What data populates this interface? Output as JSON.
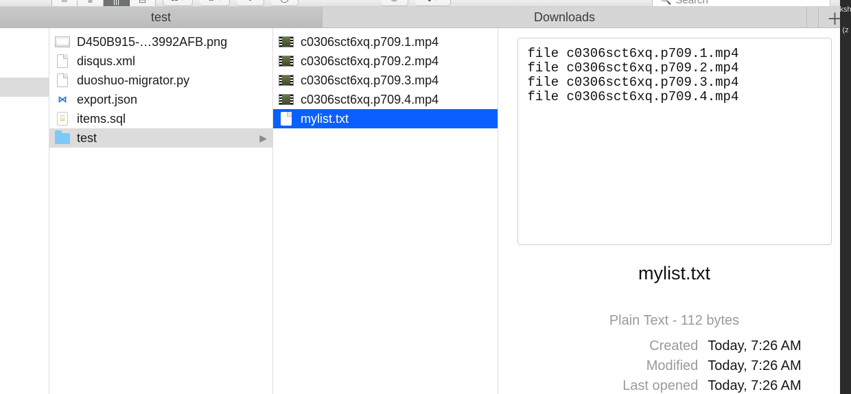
{
  "toolbar": {
    "search_placeholder": "Search"
  },
  "tabs": [
    "test",
    "Downloads"
  ],
  "active_tab_index": 0,
  "right_edge": {
    "top": "ksh",
    "sub": "(z"
  },
  "column1": {
    "items": [
      {
        "name": "D450B915-…3992AFB.png",
        "icon": "png"
      },
      {
        "name": "disqus.xml",
        "icon": "doc"
      },
      {
        "name": "duoshuo-migrator.py",
        "icon": "doc"
      },
      {
        "name": "export.json",
        "icon": "vscode"
      },
      {
        "name": "items.sql",
        "icon": "sql"
      },
      {
        "name": "test",
        "icon": "folder",
        "selected": "gray",
        "has_children": true
      }
    ]
  },
  "column2": {
    "items": [
      {
        "name": "c0306sct6xq.p709.1.mp4",
        "icon": "video"
      },
      {
        "name": "c0306sct6xq.p709.2.mp4",
        "icon": "video"
      },
      {
        "name": "c0306sct6xq.p709.3.mp4",
        "icon": "video"
      },
      {
        "name": "c0306sct6xq.p709.4.mp4",
        "icon": "video"
      },
      {
        "name": "mylist.txt",
        "icon": "doc",
        "selected": "blue"
      }
    ]
  },
  "preview": {
    "lines": [
      "file c0306sct6xq.p709.1.mp4",
      "file c0306sct6xq.p709.2.mp4",
      "file c0306sct6xq.p709.3.mp4",
      "file c0306sct6xq.p709.4.mp4"
    ],
    "filename": "mylist.txt",
    "kind": "Plain Text - 112 bytes",
    "meta": [
      {
        "k": "Created",
        "v": "Today, 7:26 AM"
      },
      {
        "k": "Modified",
        "v": "Today, 7:26 AM"
      },
      {
        "k": "Last opened",
        "v": "Today, 7:26 AM"
      }
    ]
  }
}
